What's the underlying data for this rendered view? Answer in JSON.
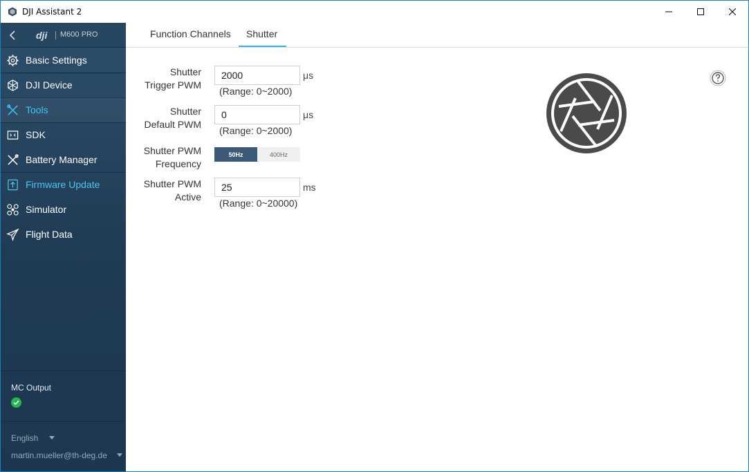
{
  "window": {
    "title": "DJI Assistant 2"
  },
  "sidebar": {
    "brand": "dji",
    "model": "M600 PRO",
    "items": [
      {
        "label": "Basic Settings",
        "icon": "gear-icon"
      },
      {
        "label": "DJI Device",
        "icon": "device-icon"
      },
      {
        "label": "Tools",
        "icon": "tools-icon"
      },
      {
        "label": "SDK",
        "icon": "sdk-icon"
      },
      {
        "label": "Battery Manager",
        "icon": "battery-tools-icon"
      },
      {
        "label": "Firmware Update",
        "icon": "firmware-icon"
      },
      {
        "label": "Simulator",
        "icon": "drone-icon"
      },
      {
        "label": "Flight Data",
        "icon": "plane-icon"
      }
    ],
    "mc_output_label": "MC Output",
    "language": "English",
    "user": "martin.mueller@th-deg.de"
  },
  "tabs": [
    {
      "label": "Function Channels"
    },
    {
      "label": "Shutter"
    }
  ],
  "shutter": {
    "trigger": {
      "label_line1": "Shutter",
      "label_line2": "Trigger PWM",
      "value": "2000",
      "unit": "μs",
      "range": "(Range:  0~2000)"
    },
    "default": {
      "label_line1": "Shutter",
      "label_line2": "Default PWM",
      "value": "0",
      "unit": "μs",
      "range": "(Range:  0~2000)"
    },
    "frequency": {
      "label_line1": "Shutter PWM",
      "label_line2": "Frequency",
      "options": [
        "50Hz",
        "400Hz"
      ],
      "selected": "50Hz"
    },
    "active": {
      "label_line1": "Shutter PWM",
      "label_line2": "Active",
      "value": "25",
      "unit": "ms",
      "range": "(Range:  0~20000)"
    }
  },
  "colors": {
    "accent": "#2fb4e6",
    "sidebar_bg": "#24435c",
    "status_ok": "#20b84a",
    "segment_active": "#3c5a77"
  }
}
